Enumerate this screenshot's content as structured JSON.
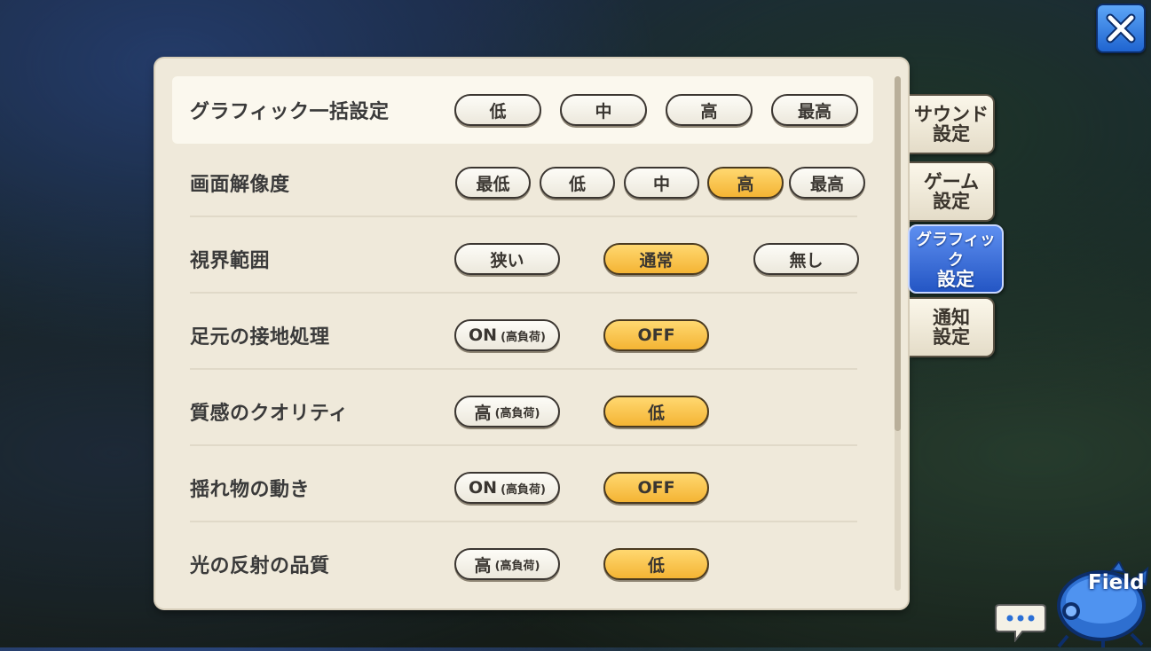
{
  "tabs": [
    {
      "line1": "サウンド",
      "line2": "設定"
    },
    {
      "line1": "ゲーム",
      "line2": "設定"
    },
    {
      "line1": "グラフィック",
      "line2": "設定"
    },
    {
      "line1": "通知",
      "line2": "設定"
    }
  ],
  "active_tab": "グラフィック設定",
  "settings": [
    {
      "label": "グラフィック一括設定",
      "options": [
        "低",
        "中",
        "高",
        "最高"
      ],
      "selected": null
    },
    {
      "label": "画面解像度",
      "options": [
        "最低",
        "低",
        "中",
        "高",
        "最高"
      ],
      "selected": "高"
    },
    {
      "label": "視界範囲",
      "options": [
        "狭い",
        "通常",
        "無し"
      ],
      "selected": "通常"
    },
    {
      "label": "足元の接地処理",
      "options": [
        {
          "main": "ON",
          "sub": "(高負荷)"
        },
        {
          "main": "OFF",
          "sub": ""
        }
      ],
      "selected": "OFF"
    },
    {
      "label": "質感のクオリティ",
      "options": [
        {
          "main": "高",
          "sub": "(高負荷)"
        },
        {
          "main": "低",
          "sub": ""
        }
      ],
      "selected": "低"
    },
    {
      "label": "揺れ物の動き",
      "options": [
        {
          "main": "ON",
          "sub": "(高負荷)"
        },
        {
          "main": "OFF",
          "sub": ""
        }
      ],
      "selected": "OFF"
    },
    {
      "label": "光の反射の品質",
      "options": [
        {
          "main": "高",
          "sub": "(高負荷)"
        },
        {
          "main": "低",
          "sub": ""
        }
      ],
      "selected": "低"
    }
  ],
  "field_button": {
    "label": "Field"
  },
  "icons": {
    "close": "close-icon",
    "chat": "chat-bubble-icon",
    "field": "field-map-icon"
  }
}
